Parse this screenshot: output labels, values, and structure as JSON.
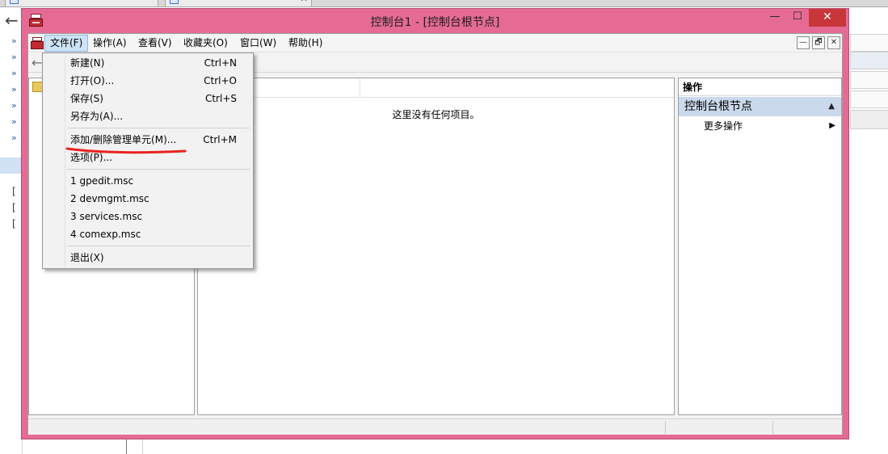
{
  "window": {
    "title": "控制台1 - [控制台根节点]",
    "minimize_glyph": "—",
    "maximize_glyph": "☐",
    "close_glyph": "✕"
  },
  "menubar": {
    "items": [
      {
        "label": "文件(F)"
      },
      {
        "label": "操作(A)"
      },
      {
        "label": "查看(V)"
      },
      {
        "label": "收藏夹(O)"
      },
      {
        "label": "窗口(W)"
      },
      {
        "label": "帮助(H)"
      }
    ],
    "mdi_minimize": "—",
    "mdi_restore": "🗗",
    "mdi_close": "✕"
  },
  "file_menu": {
    "items": [
      {
        "label": "新建(N)",
        "shortcut": "Ctrl+N"
      },
      {
        "label": "打开(O)...",
        "shortcut": "Ctrl+O"
      },
      {
        "label": "保存(S)",
        "shortcut": "Ctrl+S"
      },
      {
        "label": "另存为(A)...",
        "shortcut": ""
      },
      {
        "label": "添加/删除管理单元(M)...",
        "shortcut": "Ctrl+M"
      },
      {
        "label": "选项(P)...",
        "shortcut": ""
      },
      {
        "label": "1 gpedit.msc",
        "shortcut": ""
      },
      {
        "label": "2 devmgmt.msc",
        "shortcut": ""
      },
      {
        "label": "3 services.msc",
        "shortcut": ""
      },
      {
        "label": "4 comexp.msc",
        "shortcut": ""
      },
      {
        "label": "退出(X)",
        "shortcut": ""
      }
    ]
  },
  "results": {
    "empty_message": "这里没有任何项目。"
  },
  "actions": {
    "header": "操作",
    "node_label": "控制台根节点",
    "more_actions": "更多操作",
    "collapse_glyph": "▲",
    "expand_glyph": "▶"
  },
  "background": {
    "chevron_glyph": "»",
    "brackets": [
      "[",
      "[",
      "["
    ],
    "back_glyph": "←",
    "tab_close_glyph": "✕"
  },
  "colors": {
    "window_frame": "#e56b95",
    "close_button": "#c7373a",
    "selection": "#cad9ec",
    "annotation": "#e8231f"
  }
}
